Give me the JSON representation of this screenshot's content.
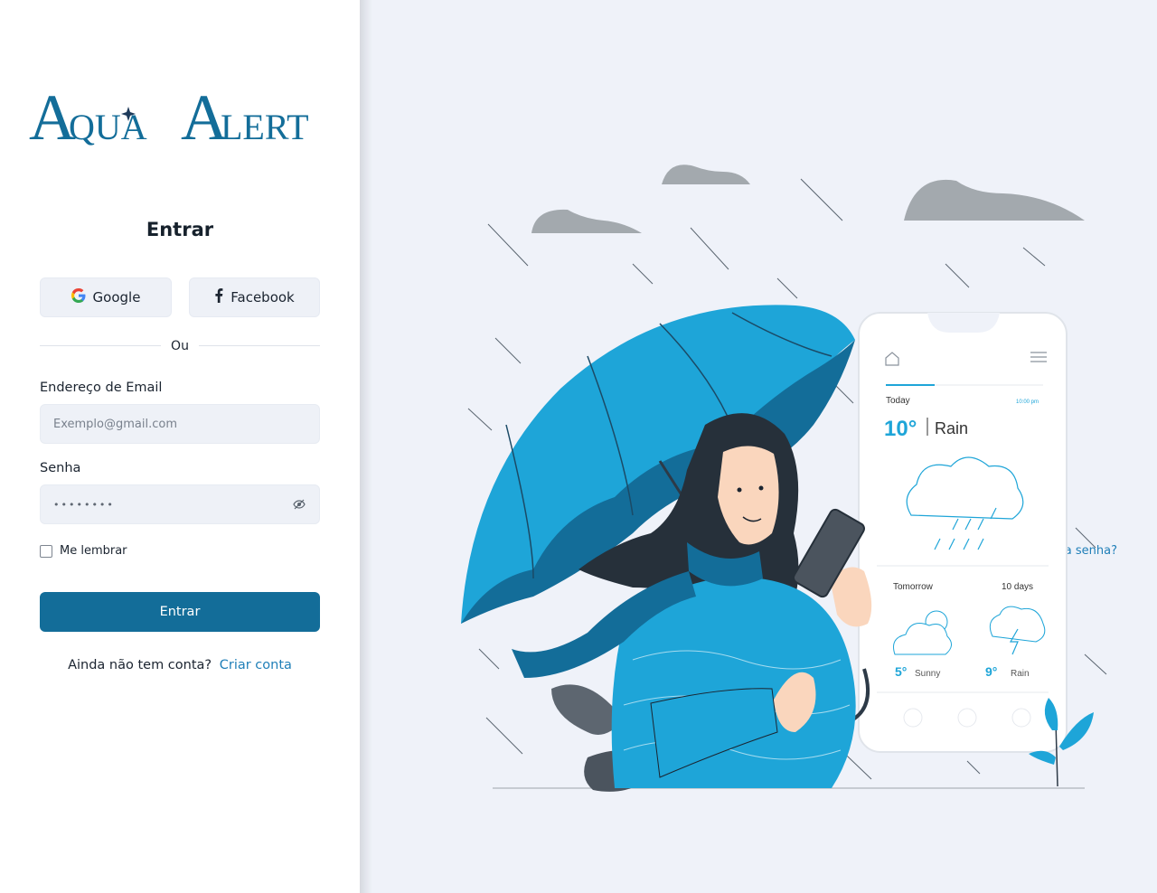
{
  "brand": {
    "logo_text": "Aqua Alert"
  },
  "login": {
    "title": "Entrar",
    "social": {
      "google_label": "Google",
      "facebook_label": "Facebook"
    },
    "divider_text": "Ou",
    "email": {
      "label": "Endereço de Email",
      "placeholder": "Exemplo@gmail.com",
      "value": ""
    },
    "password": {
      "label": "Senha",
      "masked_value": "••••••••"
    },
    "remember_label": "Me lembrar",
    "forgot_label": "Esqueceu a senha?",
    "submit_label": "Entrar",
    "signup_prompt": "Ainda não tem conta?",
    "signup_link": "Criar conta"
  },
  "illustration": {
    "phone": {
      "today_label": "Today",
      "time": "10:00 pm",
      "temp": "10°",
      "condition": "Rain",
      "tomorrow_label": "Tomorrow",
      "ten_days_label": "10 days",
      "tomorrow_temp": "5°",
      "tomorrow_condition": "Sunny",
      "ten_days_temp": "9°",
      "ten_days_condition": "Rain"
    }
  },
  "colors": {
    "primary": "#136d99",
    "link": "#1f7fb8",
    "umbrella": "#1ea5d8",
    "umbrella_dark": "#136d99",
    "background": "#eff2f9",
    "cloud": "#a3a9ae"
  },
  "icons": {
    "google": "google-icon",
    "facebook": "facebook-icon",
    "eye": "eye-off-icon"
  }
}
